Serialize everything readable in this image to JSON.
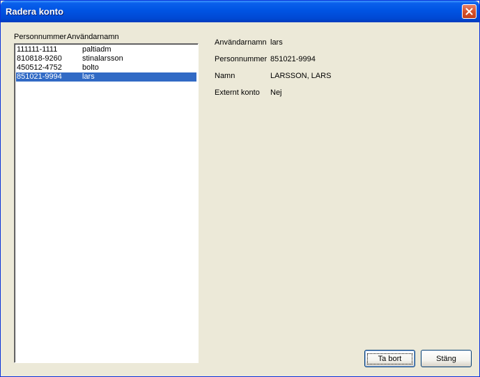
{
  "window": {
    "title": "Radera konto"
  },
  "list": {
    "headers": [
      "Personnummer",
      "Användarnamn"
    ],
    "rows": [
      {
        "personnummer": "111111-1111",
        "username": "paltiadm",
        "selected": false
      },
      {
        "personnummer": "810818-9260",
        "username": "stinalarsson",
        "selected": false
      },
      {
        "personnummer": "450512-4752",
        "username": "bolto",
        "selected": false
      },
      {
        "personnummer": "851021-9994",
        "username": "lars",
        "selected": true
      }
    ]
  },
  "details": [
    {
      "label": "Användarnamn",
      "value": "lars"
    },
    {
      "label": "Personnummer",
      "value": "851021-9994"
    },
    {
      "label": "Namn",
      "value": "LARSSON, LARS"
    },
    {
      "label": "Externt konto",
      "value": "Nej"
    }
  ],
  "buttons": {
    "delete": "Ta bort",
    "close": "Stäng"
  },
  "colors": {
    "selection": "#316AC5",
    "titlebar": "#0054E3",
    "background": "#ECE9D8"
  }
}
